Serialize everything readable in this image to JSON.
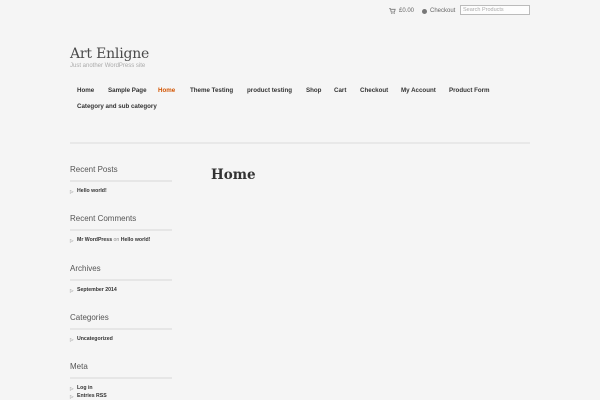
{
  "header": {
    "cart_label": "£0.00",
    "checkout_label": "Checkout",
    "search_placeholder": "Search Products"
  },
  "site": {
    "title": "Art Enligne",
    "description": "Just another WordPress site"
  },
  "nav": {
    "items": [
      {
        "label": "Home"
      },
      {
        "label": "Sample Page"
      },
      {
        "label": "Home"
      },
      {
        "label": "Theme Testing"
      },
      {
        "label": "product testing"
      },
      {
        "label": "Shop"
      },
      {
        "label": "Cart"
      },
      {
        "label": "Checkout"
      },
      {
        "label": "My Account"
      },
      {
        "label": "Product Form"
      },
      {
        "label": "Category and sub category"
      }
    ]
  },
  "sidebar": {
    "recent_posts": {
      "title": "Recent Posts",
      "items": [
        "Hello world!"
      ]
    },
    "recent_comments": {
      "title": "Recent Comments",
      "author": "Mr WordPress",
      "on": "on",
      "post": "Hello world!"
    },
    "archives": {
      "title": "Archives",
      "items": [
        "September 2014"
      ]
    },
    "categories": {
      "title": "Categories",
      "items": [
        "Uncategorized"
      ]
    },
    "meta": {
      "title": "Meta",
      "items": [
        "Log in",
        "Entries RSS"
      ]
    }
  },
  "main": {
    "heading": "Home"
  },
  "colors": {
    "accent": "#d35400",
    "background": "#f5f5f5"
  }
}
